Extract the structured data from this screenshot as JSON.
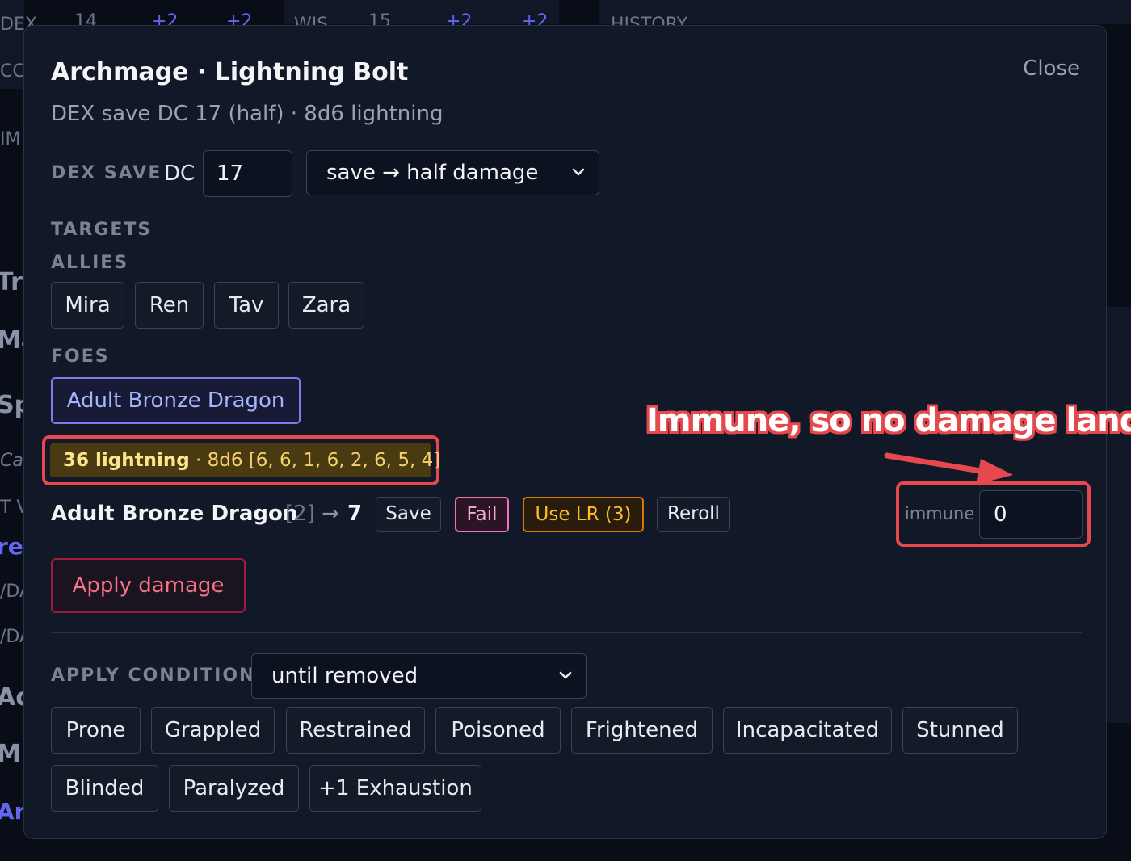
{
  "background": {
    "stats_row1": [
      "DEX",
      "14",
      "+2",
      "+2",
      "WIS",
      "15",
      "+2",
      "+2",
      "HISTORY"
    ],
    "stats_row2": "CC",
    "side_labels": [
      "IM",
      "Tra",
      "Mag",
      "Sp",
      "Cas",
      "T V",
      "re",
      "/DA",
      "/DA",
      "Ac",
      "Mu",
      "Arc"
    ]
  },
  "modal": {
    "title": "Archmage · Lightning Bolt",
    "close_label": "Close",
    "subtitle": "DEX save DC 17 (half) · 8d6 lightning"
  },
  "save": {
    "label": "DEX SAVE",
    "dc_label": "DC",
    "dc_value": "17",
    "mode_selected": "save → half damage"
  },
  "targets": {
    "label": "TARGETS",
    "allies_label": "ALLIES",
    "allies": [
      "Mira",
      "Ren",
      "Tav",
      "Zara"
    ],
    "foes_label": "FOES",
    "foes": [
      "Adult Bronze Dragon"
    ]
  },
  "roll": {
    "damage": "36 lightning",
    "detail": " · 8d6 [6, 6, 1, 6, 2, 6, 5, 4]"
  },
  "target_row": {
    "name": "Adult Bronze Dragon",
    "save_roll": "[2]",
    "arrow": "→",
    "total": "7",
    "save_label": "Save",
    "fail_label": "Fail",
    "use_lr_label": "Use LR (3)",
    "reroll_label": "Reroll",
    "immune_label": "immune",
    "damage_value": "0"
  },
  "annotation": {
    "text": "Immune, so no damage lands",
    "color": "#e5484d"
  },
  "apply_damage_label": "Apply damage",
  "condition": {
    "label": "APPLY CONDITION",
    "duration_selected": "until removed",
    "buttons": [
      "Prone",
      "Grappled",
      "Restrained",
      "Poisoned",
      "Frightened",
      "Incapacitated",
      "Stunned",
      "Blinded",
      "Paralyzed",
      "+1 Exhaustion"
    ]
  },
  "colors": {
    "modal_bg": "#111827",
    "foe_accent": "#7c7cf0",
    "damage_text": "#f5d26b",
    "fail_accent": "#f472b6",
    "lr_accent": "#d97706",
    "apply_accent": "#fb7185"
  },
  "icons": {
    "select_chevron": "chevron-down-icon",
    "annotation_arrow": "arrow-right-icon"
  }
}
